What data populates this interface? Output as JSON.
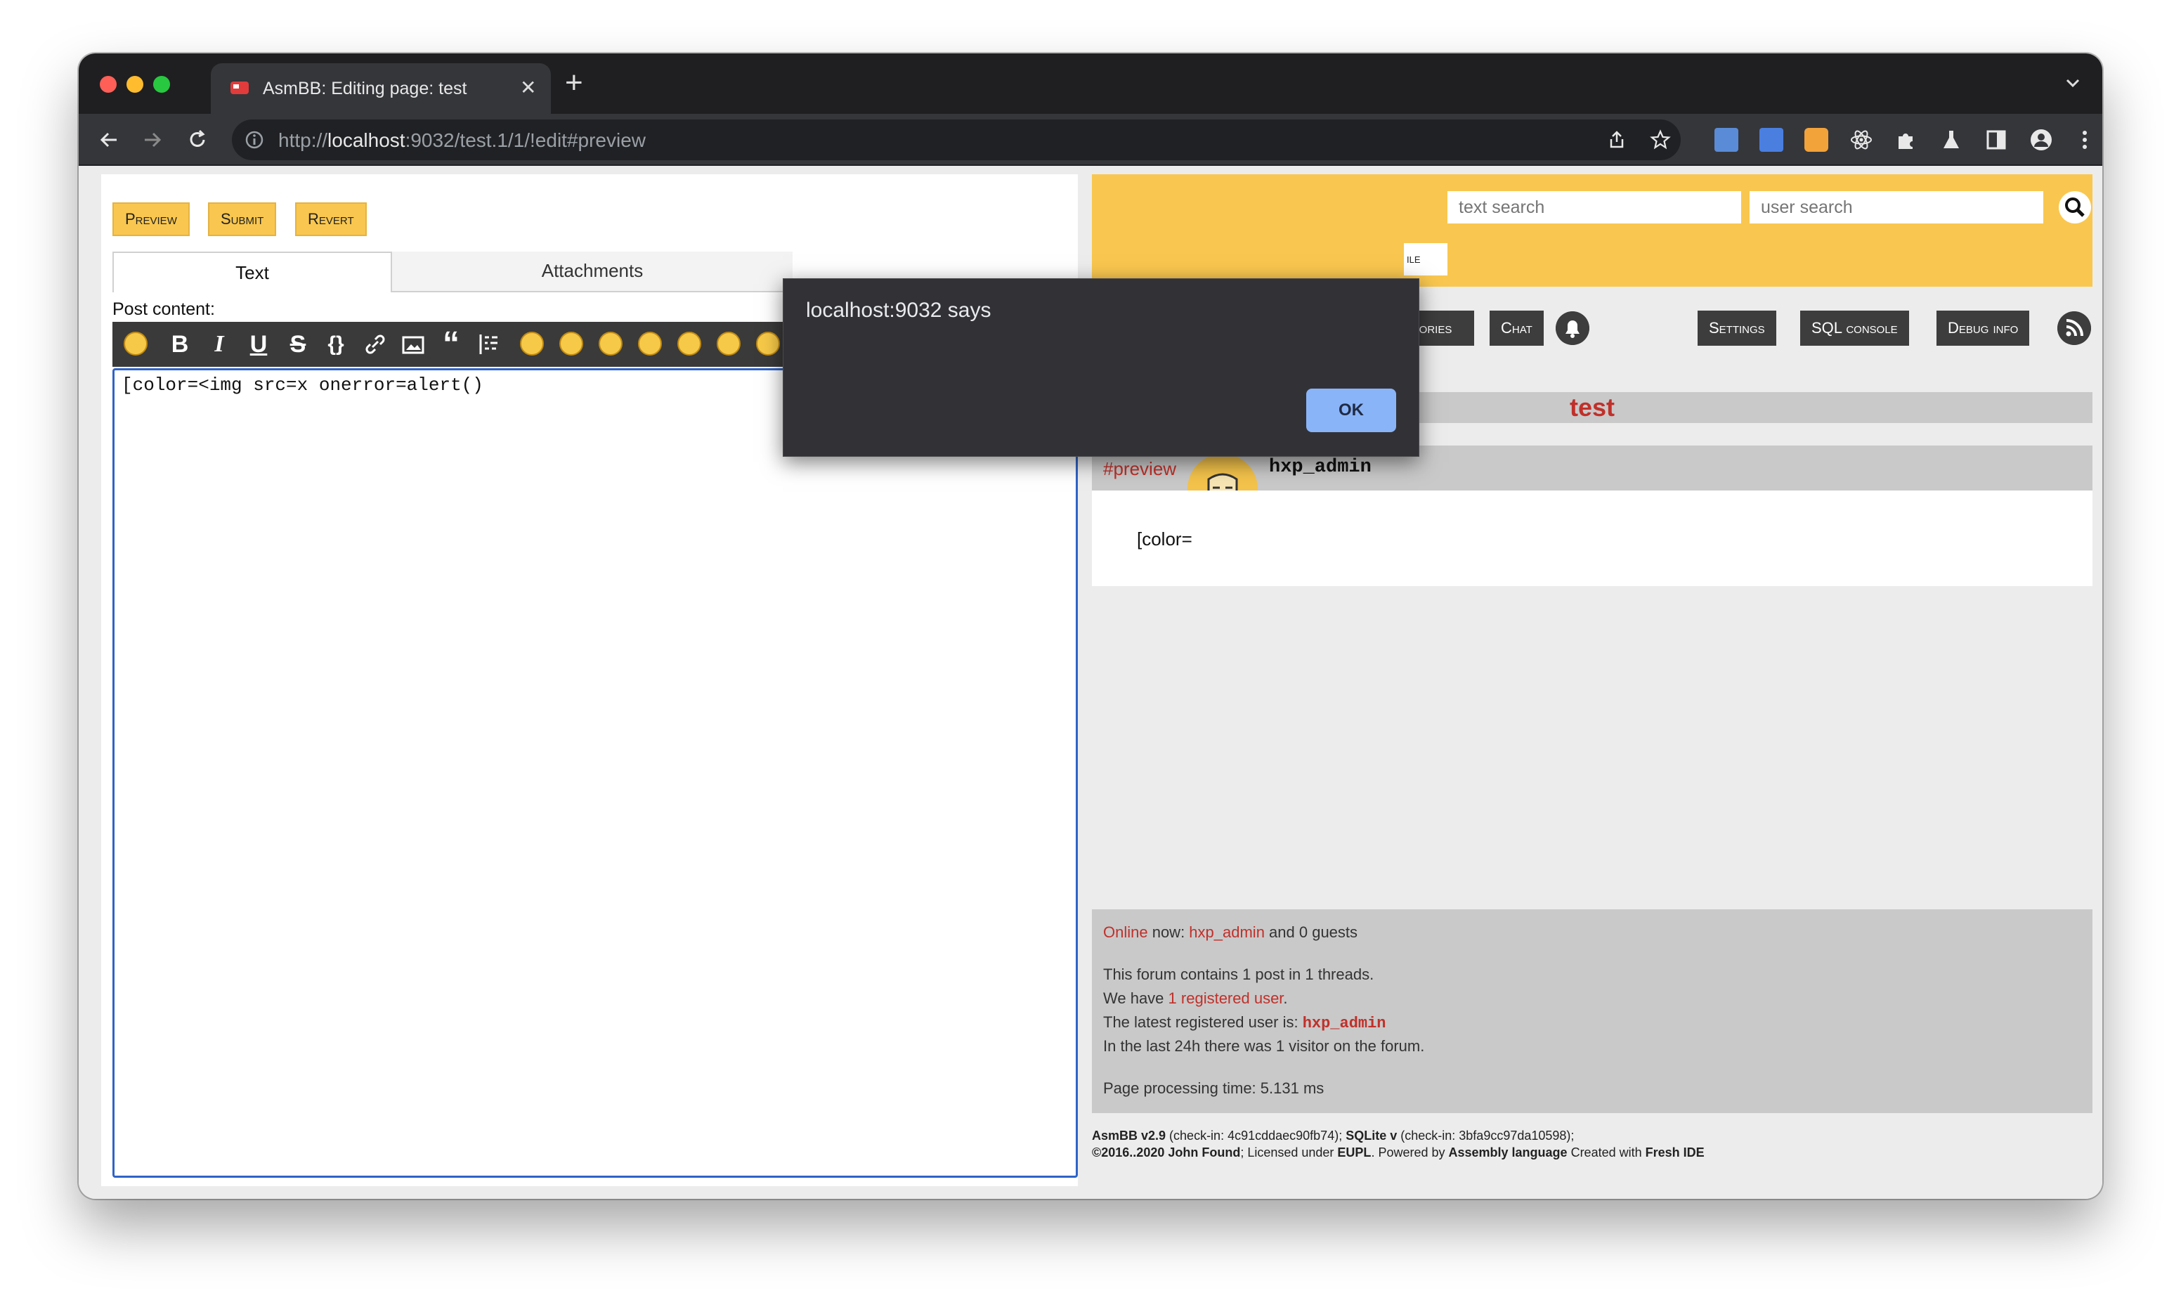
{
  "browser": {
    "tab_title": "AsmBB: Editing page: test",
    "url_scheme": "http://",
    "url_host": "localhost",
    "url_rest": ":9032/test.1/1/!edit#preview"
  },
  "editor": {
    "preview_label": "Preview",
    "submit_label": "Submit",
    "revert_label": "Revert",
    "tab_text": "Text",
    "tab_attachments": "Attachments",
    "post_content_label": "Post content:",
    "content": "[color=<img src=x onerror=alert()"
  },
  "search": {
    "text_placeholder": "text search",
    "user_placeholder": "user search",
    "profile_fragment": "ile"
  },
  "menu": {
    "categories_fragment": "gories",
    "chat": "Chat",
    "settings": "Settings",
    "sql_console": "SQL console",
    "debug_info": "Debug info"
  },
  "thread": {
    "title": "test",
    "permalink": "#preview",
    "author": "hxp_admin",
    "body": "[color="
  },
  "stats": {
    "online_link": "Online",
    "online_mid": " now: ",
    "online_user": "hxp_admin",
    "online_tail": " and 0 guests",
    "contains": "This forum contains 1 post in 1 threads.",
    "we_have": "We have ",
    "registered": "1 registered user",
    "registered_tail": ".",
    "latest_prefix": "The latest registered user is: ",
    "latest_user": "hxp_admin",
    "visitors": "In the last 24h there was 1 visitor on the forum.",
    "processing": "Page processing time: 5.131 ms"
  },
  "footer": {
    "asmbb": "AsmBB v2.9",
    "checkin1_pre": " (check-in: ",
    "checkin1": "4c91cddaec90fb74",
    "checkin1_post": "); ",
    "sqlite": "SQLite v",
    "checkin2_pre": " (check-in: ",
    "checkin2": "3bfa9cc97da10598",
    "checkin2_post": ");",
    "copyright": "©2016..2020 John Found",
    "licensed": "; Licensed under ",
    "eupl": "EUPL",
    "powered": ". Powered by ",
    "assembly": "Assembly language",
    "created": " Created with ",
    "fresh": "Fresh IDE"
  },
  "dialog": {
    "title": "localhost:9032 says",
    "ok": "OK"
  },
  "colors": {
    "accent_yellow": "#f9c74f",
    "link_red": "#c0302a",
    "dialog_bg": "#323236",
    "ok_blue": "#8ab4f8"
  }
}
